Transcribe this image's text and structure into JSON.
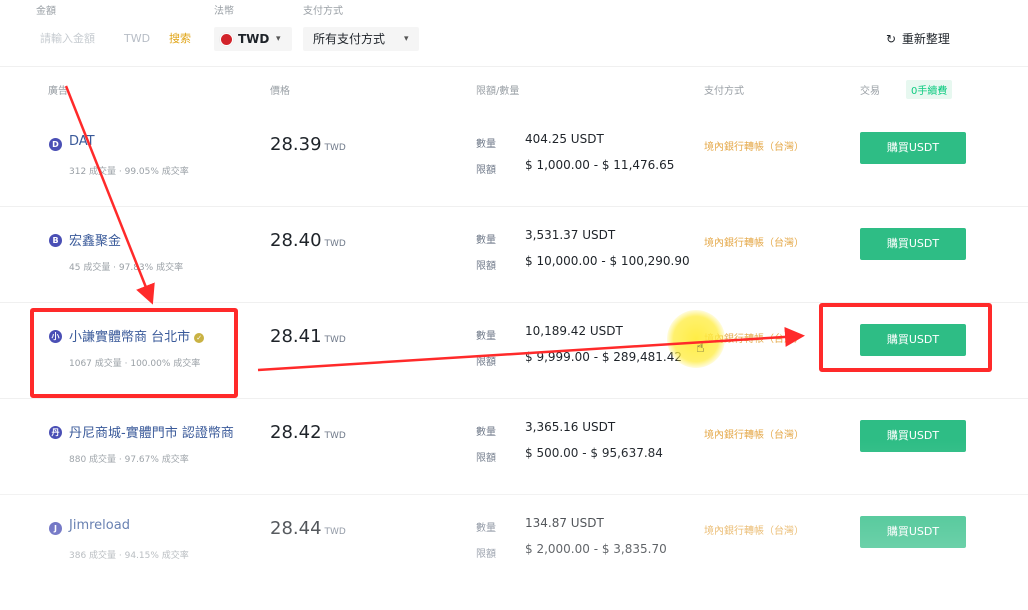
{
  "filters": {
    "amount_label": "金額",
    "fiat_label": "法幣",
    "payment_label": "支付方式",
    "amount_placeholder": "請輸入金額",
    "amount_currency": "TWD",
    "search_label": "搜索",
    "fiat_value": "TWD",
    "payment_value": "所有支付方式",
    "refresh_label": "重新整理"
  },
  "table_header": {
    "advertiser": "廣告",
    "price": "價格",
    "limit_available": "限額/數量",
    "payment": "支付方式",
    "trade": "交易",
    "fee_badge": "0手續費"
  },
  "rows": [
    {
      "icon_letter": "D",
      "name": "DAT",
      "stats": "312 成交量 · 99.05% 成交率",
      "price": "28.39",
      "price_unit": "TWD",
      "available_label": "數量",
      "available": "404.25 USDT",
      "limit_label": "限額",
      "limit": "$ 1,000.00 - $ 11,476.65",
      "payment": "境內銀行轉帳（台灣）",
      "button": "購買USDT"
    },
    {
      "icon_letter": "B",
      "name": "宏鑫聚金",
      "stats": "45 成交量 · 97.83% 成交率",
      "price": "28.40",
      "price_unit": "TWD",
      "available_label": "數量",
      "available": "3,531.37 USDT",
      "limit_label": "限額",
      "limit": "$ 10,000.00 - $ 100,290.90",
      "payment": "境內銀行轉帳（台灣）",
      "button": "購買USDT"
    },
    {
      "icon_letter": "小",
      "name": "小謙實體幣商 台北市",
      "stats": "1067 成交量 · 100.00% 成交率",
      "price": "28.41",
      "price_unit": "TWD",
      "available_label": "數量",
      "available": "10,189.42 USDT",
      "limit_label": "限額",
      "limit": "$ 9,999.00 - $ 289,481.42",
      "payment": "境內銀行轉帳（台灣）",
      "button": "購買USDT"
    },
    {
      "icon_letter": "丹",
      "name": "丹尼商城-實體門市 認證幣商",
      "stats": "880 成交量 · 97.67% 成交率",
      "price": "28.42",
      "price_unit": "TWD",
      "available_label": "數量",
      "available": "3,365.16 USDT",
      "limit_label": "限額",
      "limit": "$ 500.00 - $ 95,637.84",
      "payment": "境內銀行轉帳（台灣）",
      "button": "購買USDT"
    },
    {
      "icon_letter": "J",
      "name": "Jimreload",
      "stats": "386 成交量 · 94.15% 成交率",
      "price": "28.44",
      "price_unit": "TWD",
      "available_label": "數量",
      "available": "134.87 USDT",
      "limit_label": "限額",
      "limit": "$ 2,000.00 - $ 3,835.70",
      "payment": "境內銀行轉帳（台灣）",
      "button": "購買USDT"
    }
  ],
  "colors": {
    "buy_button": "#2ebd85",
    "annotation_red": "#ff2a2a",
    "payment_tag": "#e5a94a",
    "search_accent": "#e0a416"
  }
}
